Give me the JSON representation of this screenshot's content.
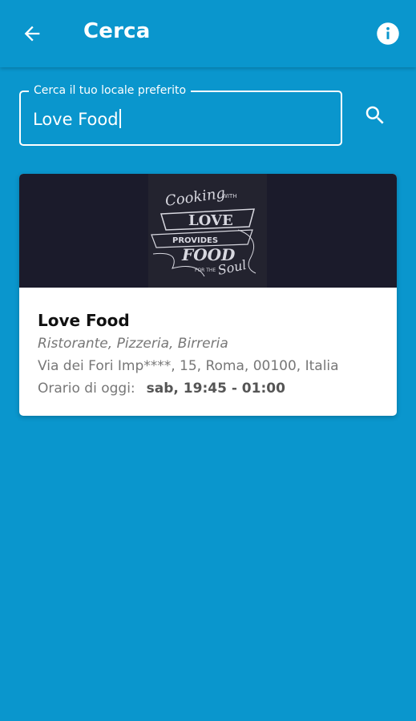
{
  "colors": {
    "primary": "#0a96cd",
    "on_primary": "#ffffff",
    "card_background": "#ffffff",
    "image_background": "#1b1b2b",
    "text_dark": "#111111",
    "text_muted": "#777777"
  },
  "appbar": {
    "title": "Cerca",
    "back_icon": "arrow-left-icon",
    "info_icon": "info-icon"
  },
  "search": {
    "label": "Cerca il tuo locale preferito",
    "value": "Love Food",
    "search_icon": "search-icon"
  },
  "results": [
    {
      "image_description_icon": "cooking-with-love-logo",
      "image_text": "Cooking with Love provides Food for the Soul",
      "name": "Love Food",
      "category": "Ristorante, Pizzeria, Birreria",
      "address": "Via dei Fori Imp****, 15, Roma, 00100, Italia",
      "hours_label": "Orario di oggi:",
      "hours_value": "sab, 19:45 - 01:00"
    }
  ]
}
